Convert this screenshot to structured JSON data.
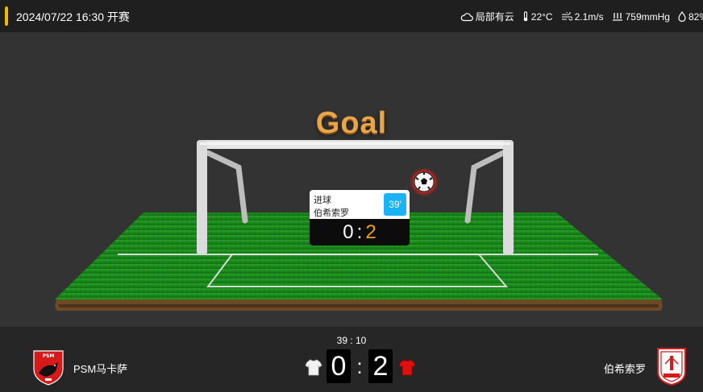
{
  "header": {
    "match_time": "2024/07/22 16:30 开赛",
    "weather": [
      {
        "icon": "cloud-icon",
        "text": "局部有云"
      },
      {
        "icon": "thermometer-icon",
        "text": "22°C"
      },
      {
        "icon": "wind-icon",
        "text": "2.1m/s"
      },
      {
        "icon": "pressure-icon",
        "text": "759mmHg"
      },
      {
        "icon": "humidity-icon",
        "text": "82%"
      }
    ]
  },
  "stage": {
    "title": "Goal",
    "event": {
      "type": "进球",
      "player": "伯希索罗",
      "minute": "39′",
      "score_home": "0",
      "score_sep": ":",
      "score_away": "2"
    }
  },
  "bottom": {
    "clock": "39 : 10",
    "home_team": "PSM马卡萨",
    "away_team": "伯希索罗",
    "score_home": "0",
    "score_sep": ":",
    "score_away": "2",
    "home_jersey_color": "#ffffff",
    "away_jersey_color": "#e01010"
  },
  "colors": {
    "accent": "#f5b800",
    "minute_badge": "#19b2f5",
    "away_score": "#f0a020",
    "pitch": "#1e8c1e"
  }
}
